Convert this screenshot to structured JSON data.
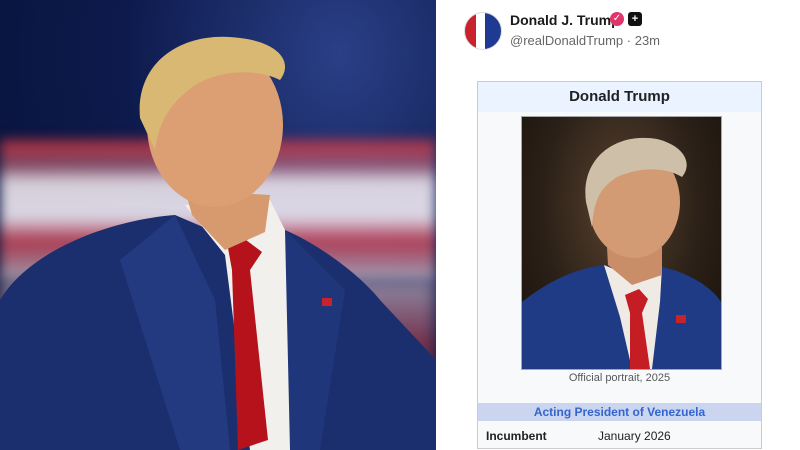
{
  "post": {
    "display_name": "Donald J. Trump",
    "handle": "@realDonaldTrump",
    "time": "· 23m",
    "verify_icon": "verified-badge-icon",
    "plus_icon": "plus-icon"
  },
  "infobox": {
    "title": "Donald Trump",
    "caption": "Official portrait, 2025",
    "office": "Acting President of Venezuela",
    "row_label": "Incumbent",
    "row_value": "January 2026"
  },
  "colors": {
    "office_band": "#ccd5f0",
    "office_text": "#3366cc",
    "verify_badge": "#e0356a"
  }
}
